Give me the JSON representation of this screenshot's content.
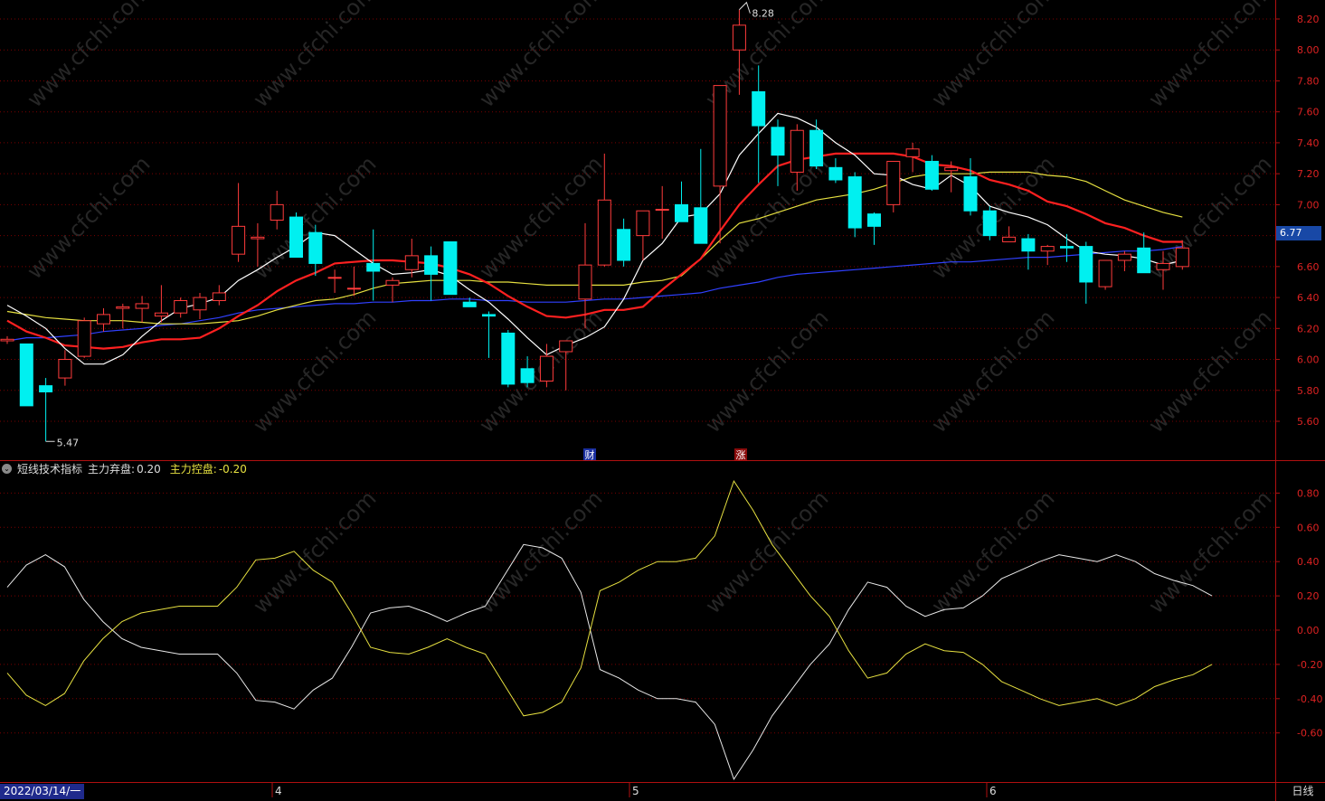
{
  "indicator": {
    "name": "短线技术指标",
    "line1_label": "主力弃盘:",
    "line1_value": "0.20",
    "line2_label": "主力控盘:",
    "line2_value": "-0.20"
  },
  "status_bar": {
    "start_date": "2022/03/14/一",
    "period": "日线",
    "month_ticks": [
      "4",
      "5",
      "6"
    ]
  },
  "price_panel": {
    "last_price": "6.77",
    "high_label": "8.28",
    "low_label": "5.47",
    "event_labels": [
      "财",
      "涨"
    ]
  },
  "watermark": "www.cfchi.com",
  "colors": {
    "up": "#ff3b3b",
    "down": "#00f0f0",
    "ma5": "#ffffff",
    "ma10": "#ff2020",
    "ma20": "#e6e040",
    "ma60": "#3040ff",
    "axis": "#b01010",
    "grid": "#7a0000"
  },
  "chart_data": [
    {
      "type": "candlestick",
      "title": "",
      "y_ticks": [
        "8.20",
        "8.00",
        "7.80",
        "7.60",
        "7.40",
        "7.20",
        "7.00",
        "6.80",
        "6.60",
        "6.40",
        "6.20",
        "6.00",
        "5.80",
        "5.60"
      ],
      "ylim": [
        5.4,
        8.3
      ],
      "ohlc": [
        [
          6.12,
          6.15,
          6.1,
          6.13
        ],
        [
          6.1,
          6.1,
          5.7,
          5.7
        ],
        [
          5.83,
          5.88,
          5.47,
          5.79
        ],
        [
          5.88,
          6.06,
          5.83,
          6.0
        ],
        [
          6.02,
          6.27,
          6.01,
          6.25
        ],
        [
          6.23,
          6.33,
          6.18,
          6.29
        ],
        [
          6.33,
          6.36,
          6.2,
          6.34
        ],
        [
          6.33,
          6.41,
          6.24,
          6.36
        ],
        [
          6.28,
          6.48,
          6.24,
          6.3
        ],
        [
          6.3,
          6.4,
          6.27,
          6.38
        ],
        [
          6.32,
          6.43,
          6.26,
          6.4
        ],
        [
          6.38,
          6.48,
          6.35,
          6.43
        ],
        [
          6.68,
          7.14,
          6.63,
          6.86
        ],
        [
          6.78,
          6.88,
          6.6,
          6.79
        ],
        [
          6.9,
          7.09,
          6.84,
          7.0
        ],
        [
          6.92,
          6.95,
          6.67,
          6.66
        ],
        [
          6.82,
          6.87,
          6.54,
          6.62
        ],
        [
          6.53,
          6.58,
          6.43,
          6.53
        ],
        [
          6.46,
          6.6,
          6.41,
          6.46
        ],
        [
          6.62,
          6.84,
          6.38,
          6.57
        ],
        [
          6.48,
          6.53,
          6.37,
          6.51
        ],
        [
          6.58,
          6.78,
          6.53,
          6.67
        ],
        [
          6.67,
          6.73,
          6.38,
          6.55
        ],
        [
          6.76,
          6.76,
          6.42,
          6.42
        ],
        [
          6.37,
          6.4,
          6.36,
          6.34
        ],
        [
          6.29,
          6.31,
          6.01,
          6.28
        ],
        [
          6.17,
          6.19,
          5.82,
          5.84
        ],
        [
          5.94,
          6.02,
          5.82,
          5.85
        ],
        [
          5.86,
          6.1,
          5.82,
          6.02
        ],
        [
          6.05,
          6.12,
          5.8,
          6.12
        ],
        [
          6.39,
          6.88,
          6.2,
          6.61
        ],
        [
          6.61,
          7.33,
          6.6,
          7.03
        ],
        [
          6.84,
          6.91,
          6.6,
          6.64
        ],
        [
          6.8,
          6.93,
          6.64,
          6.96
        ],
        [
          6.97,
          7.12,
          6.78,
          6.97
        ],
        [
          7.0,
          7.15,
          6.95,
          6.89
        ],
        [
          6.98,
          7.36,
          6.8,
          6.75
        ],
        [
          7.12,
          7.22,
          6.75,
          7.77
        ],
        [
          8.0,
          8.26,
          7.71,
          8.16
        ],
        [
          7.73,
          7.9,
          7.14,
          7.51
        ],
        [
          7.5,
          7.55,
          7.12,
          7.32
        ],
        [
          7.21,
          7.52,
          7.09,
          7.48
        ],
        [
          7.48,
          7.55,
          7.23,
          7.25
        ],
        [
          7.24,
          7.3,
          7.14,
          7.16
        ],
        [
          7.18,
          7.21,
          6.79,
          6.85
        ],
        [
          6.94,
          6.95,
          6.74,
          6.86
        ],
        [
          7.0,
          7.25,
          6.95,
          7.28
        ],
        [
          7.31,
          7.4,
          7.21,
          7.36
        ],
        [
          7.28,
          7.32,
          7.09,
          7.1
        ],
        [
          7.22,
          7.28,
          7.08,
          7.24
        ],
        [
          7.18,
          7.3,
          6.93,
          6.96
        ],
        [
          6.96,
          6.99,
          6.77,
          6.8
        ],
        [
          6.76,
          6.86,
          6.76,
          6.79
        ],
        [
          6.78,
          6.81,
          6.58,
          6.7
        ],
        [
          6.7,
          6.74,
          6.61,
          6.73
        ],
        [
          6.73,
          6.81,
          6.63,
          6.72
        ],
        [
          6.73,
          6.76,
          6.36,
          6.5
        ],
        [
          6.47,
          6.58,
          6.45,
          6.64
        ],
        [
          6.64,
          6.7,
          6.57,
          6.68
        ],
        [
          6.72,
          6.82,
          6.6,
          6.56
        ],
        [
          6.58,
          6.7,
          6.45,
          6.62
        ],
        [
          6.6,
          6.77,
          6.58,
          6.72
        ]
      ],
      "ma5": [
        6.35,
        6.28,
        6.2,
        6.07,
        5.97,
        5.97,
        6.03,
        6.15,
        6.25,
        6.33,
        6.36,
        6.4,
        6.51,
        6.58,
        6.66,
        6.73,
        6.82,
        6.8,
        6.71,
        6.62,
        6.55,
        6.56,
        6.58,
        6.54,
        6.45,
        6.37,
        6.26,
        6.14,
        6.03,
        6.09,
        6.14,
        6.21,
        6.39,
        6.64,
        6.75,
        6.92,
        6.94,
        7.07,
        7.32,
        7.46,
        7.59,
        7.56,
        7.5,
        7.4,
        7.32,
        7.2,
        7.19,
        7.13,
        7.1,
        7.19,
        7.12,
        6.99,
        6.95,
        6.92,
        6.87,
        6.78,
        6.7,
        6.68,
        6.67,
        6.65,
        6.61,
        6.64
      ],
      "ma10": [
        6.25,
        6.18,
        6.14,
        6.09,
        6.08,
        6.07,
        6.08,
        6.11,
        6.13,
        6.13,
        6.14,
        6.2,
        6.28,
        6.35,
        6.44,
        6.51,
        6.56,
        6.62,
        6.63,
        6.64,
        6.64,
        6.63,
        6.62,
        6.59,
        6.55,
        6.49,
        6.41,
        6.34,
        6.28,
        6.27,
        6.29,
        6.32,
        6.32,
        6.34,
        6.45,
        6.55,
        6.65,
        6.83,
        7.0,
        7.13,
        7.25,
        7.29,
        7.31,
        7.33,
        7.33,
        7.33,
        7.33,
        7.31,
        7.26,
        7.25,
        7.22,
        7.16,
        7.13,
        7.09,
        7.02,
        6.99,
        6.94,
        6.88,
        6.85,
        6.8,
        6.76,
        6.76
      ],
      "ma20": [
        6.31,
        6.29,
        6.27,
        6.26,
        6.25,
        6.25,
        6.25,
        6.24,
        6.23,
        6.23,
        6.23,
        6.24,
        6.25,
        6.28,
        6.32,
        6.35,
        6.38,
        6.39,
        6.42,
        6.46,
        6.49,
        6.5,
        6.51,
        6.51,
        6.51,
        6.5,
        6.5,
        6.49,
        6.48,
        6.48,
        6.48,
        6.48,
        6.48,
        6.5,
        6.51,
        6.54,
        6.65,
        6.77,
        6.88,
        6.91,
        6.95,
        6.99,
        7.03,
        7.05,
        7.07,
        7.1,
        7.14,
        7.18,
        7.2,
        7.2,
        7.2,
        7.21,
        7.21,
        7.21,
        7.19,
        7.18,
        7.15,
        7.09,
        7.03,
        6.99,
        6.95,
        6.92
      ],
      "ma60": [
        6.12,
        6.14,
        6.14,
        6.15,
        6.16,
        6.18,
        6.19,
        6.2,
        6.22,
        6.23,
        6.25,
        6.27,
        6.3,
        6.32,
        6.33,
        6.34,
        6.35,
        6.36,
        6.36,
        6.37,
        6.37,
        6.38,
        6.38,
        6.39,
        6.39,
        6.38,
        6.38,
        6.37,
        6.37,
        6.37,
        6.38,
        6.39,
        6.39,
        6.4,
        6.41,
        6.42,
        6.43,
        6.46,
        6.48,
        6.5,
        6.53,
        6.55,
        6.56,
        6.57,
        6.58,
        6.59,
        6.6,
        6.61,
        6.62,
        6.63,
        6.63,
        6.64,
        6.65,
        6.66,
        6.66,
        6.67,
        6.68,
        6.69,
        6.7,
        6.7,
        6.71,
        6.73
      ]
    },
    {
      "type": "line",
      "title": "",
      "y_ticks": [
        "0.80",
        "0.60",
        "0.40",
        "0.20",
        "0.00",
        "-0.20",
        "-0.40",
        "-0.60"
      ],
      "ylim": [
        -0.88,
        0.88
      ],
      "series": [
        {
          "name": "主力弃盘",
          "values": [
            0.25,
            0.38,
            0.44,
            0.37,
            0.18,
            0.05,
            -0.05,
            -0.1,
            -0.12,
            -0.14,
            -0.14,
            -0.14,
            -0.25,
            -0.41,
            -0.42,
            -0.46,
            -0.35,
            -0.28,
            -0.1,
            0.1,
            0.13,
            0.14,
            0.1,
            0.05,
            0.1,
            0.14,
            0.32,
            0.5,
            0.48,
            0.42,
            0.22,
            -0.23,
            -0.28,
            -0.35,
            -0.4,
            -0.4,
            -0.42,
            -0.55,
            -0.87,
            -0.7,
            -0.5,
            -0.35,
            -0.2,
            -0.08,
            0.12,
            0.28,
            0.25,
            0.14,
            0.08,
            0.12,
            0.13,
            0.2,
            0.3,
            0.35,
            0.4,
            0.44,
            0.42,
            0.4,
            0.44,
            0.4,
            0.33,
            0.29,
            0.26,
            0.2
          ]
        },
        {
          "name": "主力控盘",
          "values": [
            -0.25,
            -0.38,
            -0.44,
            -0.37,
            -0.18,
            -0.05,
            0.05,
            0.1,
            0.12,
            0.14,
            0.14,
            0.14,
            0.25,
            0.41,
            0.42,
            0.46,
            0.35,
            0.28,
            0.1,
            -0.1,
            -0.13,
            -0.14,
            -0.1,
            -0.05,
            -0.1,
            -0.14,
            -0.32,
            -0.5,
            -0.48,
            -0.42,
            -0.22,
            0.23,
            0.28,
            0.35,
            0.4,
            0.4,
            0.42,
            0.55,
            0.87,
            0.7,
            0.5,
            0.35,
            0.2,
            0.08,
            -0.12,
            -0.28,
            -0.25,
            -0.14,
            -0.08,
            -0.12,
            -0.13,
            -0.2,
            -0.3,
            -0.35,
            -0.4,
            -0.44,
            -0.42,
            -0.4,
            -0.44,
            -0.4,
            -0.33,
            -0.29,
            -0.26,
            -0.2
          ]
        }
      ]
    }
  ]
}
